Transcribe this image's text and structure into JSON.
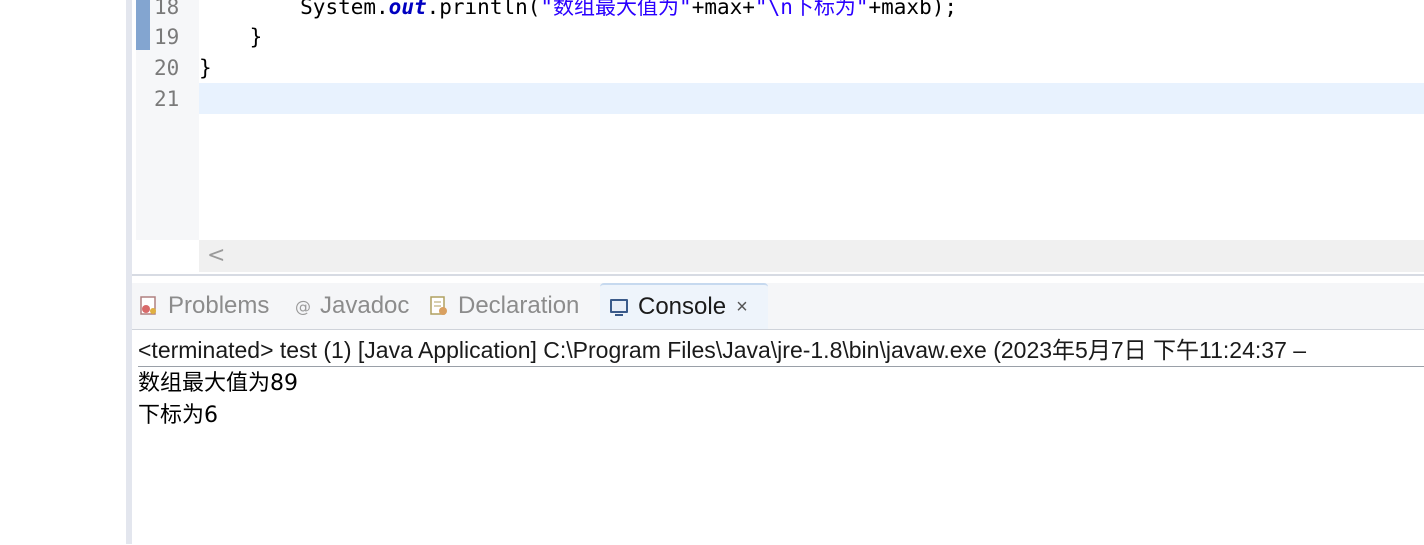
{
  "editor": {
    "line_numbers": [
      "18",
      "19",
      "20",
      "21"
    ],
    "lines": [
      {
        "indent": "        ",
        "prefix": "System.",
        "out": "out",
        "call": ".println(",
        "str1": "\"数组最大值为\"",
        "mid": "+max+",
        "str2": "\"\\n下标为\"",
        "suffix": "+maxb);"
      },
      {
        "text": "    }"
      },
      {
        "text": "}"
      },
      {
        "text": ""
      }
    ],
    "scroll_left_glyph": "<"
  },
  "tabs": [
    {
      "label": "Problems",
      "icon": "problems-icon"
    },
    {
      "label": "Javadoc",
      "icon": "at-icon"
    },
    {
      "label": "Declaration",
      "icon": "declaration-icon"
    },
    {
      "label": "Console",
      "icon": "console-icon",
      "active": true,
      "close": "×"
    }
  ],
  "console": {
    "header": "<terminated> test (1) [Java Application] C:\\Program Files\\Java\\jre-1.8\\bin\\javaw.exe  (2023年5月7日 下午11:24:37 –",
    "output": [
      "数组最大值为89",
      "下标为6"
    ]
  },
  "colors": {
    "current_line": "#e8f2fe",
    "string": "#2a00ff",
    "field": "#0000c0",
    "change_marker": "#6f97c9"
  }
}
